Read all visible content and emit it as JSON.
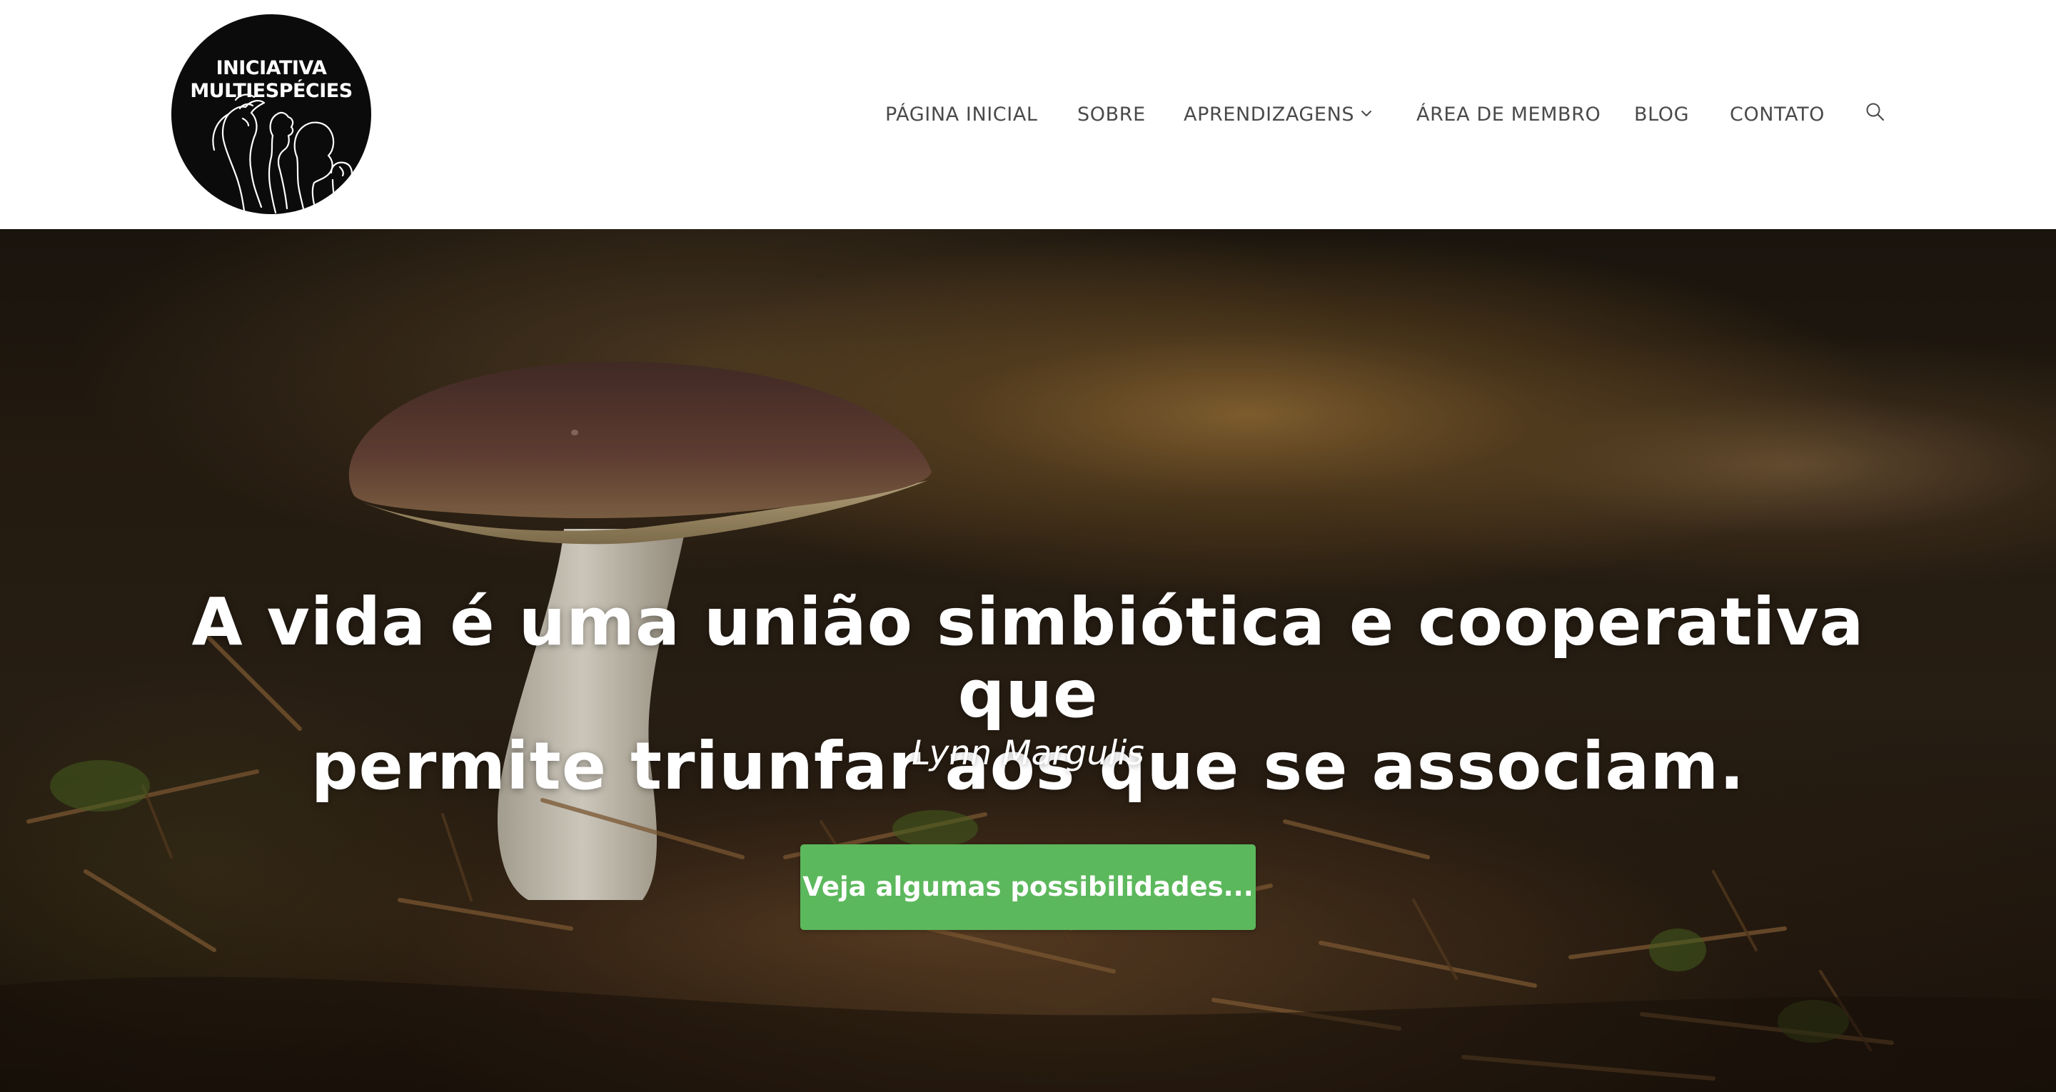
{
  "logo": {
    "line1": "INICIATIVA",
    "line2": "MULTIESPÉCIES"
  },
  "nav": {
    "items": [
      {
        "label": "PÁGINA INICIAL"
      },
      {
        "label": "SOBRE"
      },
      {
        "label": "APRENDIZAGENS",
        "has_dropdown": true
      },
      {
        "label": "ÁREA DE MEMBRO"
      },
      {
        "label": "BLOG"
      },
      {
        "label": "CONTATO"
      }
    ],
    "search_icon": "search-icon",
    "dropdown_icon": "chevron-down-icon"
  },
  "hero": {
    "quote_line1": "A vida é uma união simbiótica e cooperativa que",
    "quote_line2": "permite triunfar aos que se associam.",
    "author": "Lynn Margulis",
    "button_label": "Veja algumas possibilidades...",
    "button_color": "#5cb85c"
  },
  "colors": {
    "nav_text": "#4a4a4a",
    "logo_background": "#0b0b0b",
    "hero_text": "#ffffff"
  }
}
